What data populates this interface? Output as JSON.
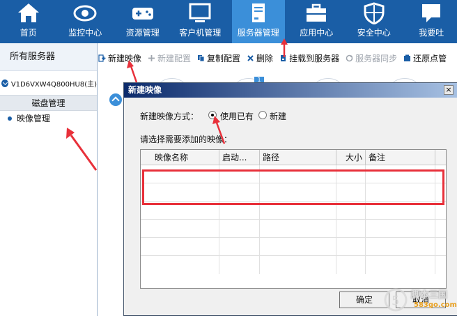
{
  "nav": {
    "items": [
      {
        "label": "首页",
        "icon": "home-icon"
      },
      {
        "label": "监控中心",
        "icon": "eye-icon"
      },
      {
        "label": "资源管理",
        "icon": "gamepad-icon"
      },
      {
        "label": "客户机管理",
        "icon": "monitor-icon"
      },
      {
        "label": "服务器管理",
        "icon": "server-document-icon",
        "active": true
      },
      {
        "label": "应用中心",
        "icon": "toolbox-icon"
      },
      {
        "label": "安全中心",
        "icon": "shield-icon"
      },
      {
        "label": "我要吐",
        "icon": "chat-icon"
      }
    ]
  },
  "sidebar": {
    "header": "所有服务器",
    "server": "V1D6VXW4Q800HU8(主)",
    "items": [
      {
        "label": "磁盘管理"
      },
      {
        "label": "映像管理",
        "selected": true
      }
    ]
  },
  "toolbar": {
    "buttons": [
      {
        "label": "新建映像",
        "enabled": true
      },
      {
        "label": "新建配置",
        "enabled": false
      },
      {
        "label": "复制配置",
        "enabled": true
      },
      {
        "label": "删除",
        "enabled": true
      },
      {
        "label": "挂载到服务器",
        "enabled": true
      },
      {
        "label": "服务器同步",
        "enabled": false
      },
      {
        "label": "还原点管",
        "enabled": true
      }
    ]
  },
  "background": {
    "badge": "1"
  },
  "dialog": {
    "title": "新建映像",
    "close": "×",
    "mode_label": "新建映像方式：",
    "options": [
      {
        "label": "使用已有",
        "checked": true
      },
      {
        "label": "新建",
        "checked": false
      }
    ],
    "list_label": "请选择需要添加的映像：",
    "columns": [
      "映像名称",
      "启动...",
      "路径",
      "大小",
      "备注"
    ],
    "ok": "确定",
    "cancel": "取消"
  },
  "watermark": {
    "brand": "脚本三国",
    "url": "583go.com"
  },
  "colors": {
    "nav_bg": "#1a5ea6",
    "nav_active": "#3b8fd9",
    "annotation_red": "#e8303a"
  }
}
